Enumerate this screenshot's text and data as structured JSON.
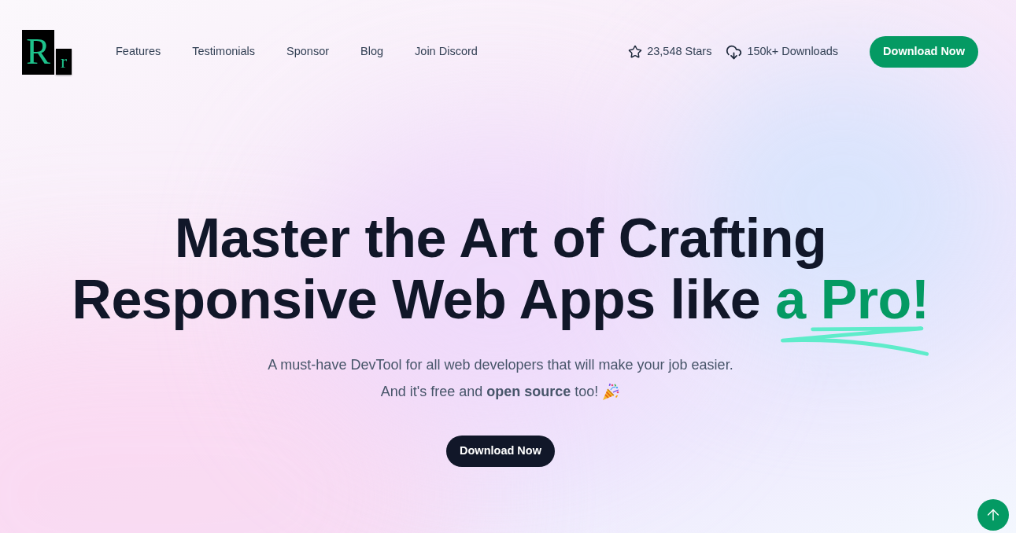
{
  "logo": {
    "letters": [
      "R",
      "r"
    ]
  },
  "nav": {
    "links": [
      {
        "label": "Features"
      },
      {
        "label": "Testimonials"
      },
      {
        "label": "Sponsor"
      },
      {
        "label": "Blog"
      },
      {
        "label": "Join Discord"
      }
    ]
  },
  "stats": [
    {
      "kind": "stars",
      "text": "23,548 Stars"
    },
    {
      "kind": "downloads",
      "text": "150k+ Downloads"
    }
  ],
  "header_button": "Download Now",
  "hero": {
    "headline_line_1": "Master the Art of Crafting",
    "headline_line_2": "Responsive Web Apps like",
    "headline_highlight": "a Pro!",
    "subtitle_line_1": "A must-have DevTool for all web developers that will make your job easier.",
    "subtitle_line_2": "And it's free and **open source** too!",
    "button": "Download Now"
  }
}
